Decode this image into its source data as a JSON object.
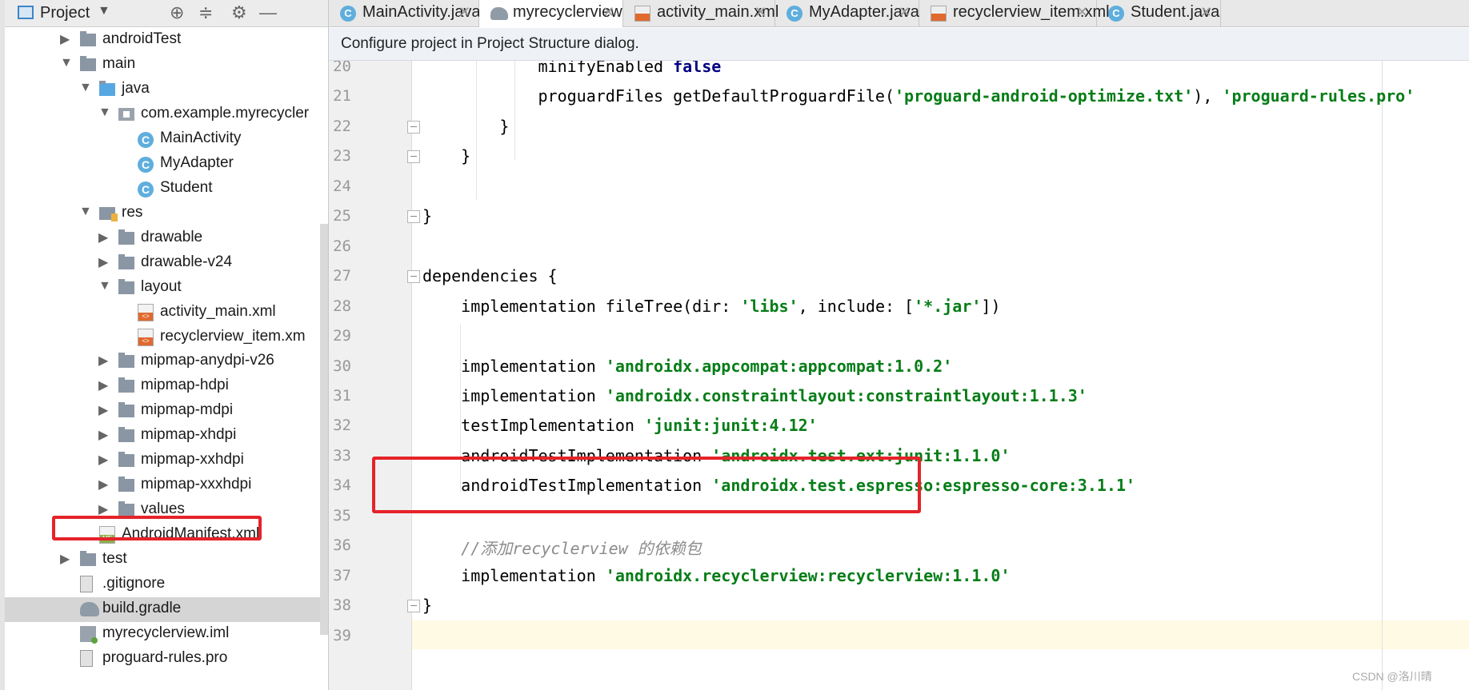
{
  "project_panel": {
    "title": "Project",
    "tree": [
      {
        "label": "androidTest",
        "icon": "folder-icon"
      },
      {
        "label": "main",
        "icon": "folder-icon"
      },
      {
        "label": "java",
        "icon": "java-folder-icon"
      },
      {
        "label": "com.example.myrecycler",
        "icon": "package-icon"
      },
      {
        "label": "MainActivity",
        "icon": "class-icon"
      },
      {
        "label": "MyAdapter",
        "icon": "class-icon"
      },
      {
        "label": "Student",
        "icon": "class-icon"
      },
      {
        "label": "res",
        "icon": "res-folder-icon"
      },
      {
        "label": "drawable",
        "icon": "folder-icon"
      },
      {
        "label": "drawable-v24",
        "icon": "folder-icon"
      },
      {
        "label": "layout",
        "icon": "folder-icon"
      },
      {
        "label": "activity_main.xml",
        "icon": "xml-file-icon"
      },
      {
        "label": "recyclerview_item.xm",
        "icon": "xml-file-icon"
      },
      {
        "label": "mipmap-anydpi-v26",
        "icon": "folder-icon"
      },
      {
        "label": "mipmap-hdpi",
        "icon": "folder-icon"
      },
      {
        "label": "mipmap-mdpi",
        "icon": "folder-icon"
      },
      {
        "label": "mipmap-xhdpi",
        "icon": "folder-icon"
      },
      {
        "label": "mipmap-xxhdpi",
        "icon": "folder-icon"
      },
      {
        "label": "mipmap-xxxhdpi",
        "icon": "folder-icon"
      },
      {
        "label": "values",
        "icon": "folder-icon"
      },
      {
        "label": "AndroidManifest.xml",
        "icon": "manifest-icon"
      },
      {
        "label": "test",
        "icon": "folder-icon"
      },
      {
        "label": ".gitignore",
        "icon": "text-file-icon"
      },
      {
        "label": "build.gradle",
        "icon": "gradle-icon",
        "selected": true
      },
      {
        "label": "myrecyclerview.iml",
        "icon": "iml-file-icon"
      },
      {
        "label": "proguard-rules.pro",
        "icon": "text-file-icon"
      }
    ]
  },
  "tabs": [
    {
      "label": "MainActivity.java",
      "icon": "class-icon"
    },
    {
      "label": "myrecyclerview",
      "icon": "gradle-icon",
      "active": true
    },
    {
      "label": "activity_main.xml",
      "icon": "xml-file-icon"
    },
    {
      "label": "MyAdapter.java",
      "icon": "class-icon"
    },
    {
      "label": "recyclerview_item.xml",
      "icon": "xml-file-icon"
    },
    {
      "label": "Student.java",
      "icon": "class-icon"
    }
  ],
  "banner": {
    "text": "Configure project in Project Structure dialog."
  },
  "editor": {
    "lines": [
      {
        "num": "20",
        "segments": [
          {
            "t": "            minifyEnabled ",
            "c": ""
          },
          {
            "t": "false",
            "c": "kw"
          }
        ]
      },
      {
        "num": "21",
        "segments": [
          {
            "t": "            proguardFiles getDefaultProguardFile(",
            "c": ""
          },
          {
            "t": "'proguard-android-optimize.txt'",
            "c": "str"
          },
          {
            "t": "), ",
            "c": ""
          },
          {
            "t": "'proguard-rules.pro'",
            "c": "str"
          }
        ]
      },
      {
        "num": "22",
        "segments": [
          {
            "t": "        }",
            "c": ""
          }
        ]
      },
      {
        "num": "23",
        "segments": [
          {
            "t": "    }",
            "c": ""
          }
        ]
      },
      {
        "num": "24",
        "segments": []
      },
      {
        "num": "25",
        "segments": [
          {
            "t": "}",
            "c": ""
          }
        ]
      },
      {
        "num": "26",
        "segments": []
      },
      {
        "num": "27",
        "segments": [
          {
            "t": "dependencies {",
            "c": ""
          }
        ]
      },
      {
        "num": "28",
        "segments": [
          {
            "t": "    implementation fileTree(dir: ",
            "c": ""
          },
          {
            "t": "'libs'",
            "c": "str"
          },
          {
            "t": ", include: [",
            "c": ""
          },
          {
            "t": "'*.jar'",
            "c": "str"
          },
          {
            "t": "])",
            "c": ""
          }
        ]
      },
      {
        "num": "29",
        "segments": []
      },
      {
        "num": "30",
        "segments": [
          {
            "t": "    implementation ",
            "c": ""
          },
          {
            "t": "'androidx.appcompat:appcompat:1.0.2'",
            "c": "str"
          }
        ]
      },
      {
        "num": "31",
        "segments": [
          {
            "t": "    implementation ",
            "c": ""
          },
          {
            "t": "'androidx.constraintlayout:constraintlayout:1.1.3'",
            "c": "str"
          }
        ]
      },
      {
        "num": "32",
        "segments": [
          {
            "t": "    testImplementation ",
            "c": ""
          },
          {
            "t": "'junit:junit:4.12'",
            "c": "str"
          }
        ]
      },
      {
        "num": "33",
        "segments": [
          {
            "t": "    androidTestImplementation ",
            "c": ""
          },
          {
            "t": "'androidx.test.ext:junit:1.1.0'",
            "c": "str"
          }
        ]
      },
      {
        "num": "34",
        "segments": [
          {
            "t": "    androidTestImplementation ",
            "c": ""
          },
          {
            "t": "'androidx.test.espresso:espresso-core:3.1.1'",
            "c": "str"
          }
        ]
      },
      {
        "num": "35",
        "segments": []
      },
      {
        "num": "36",
        "segments": [
          {
            "t": "    //添加recyclerview 的依赖包",
            "c": "cmt"
          }
        ]
      },
      {
        "num": "37",
        "segments": [
          {
            "t": "    implementation ",
            "c": ""
          },
          {
            "t": "'androidx.recyclerview:recyclerview:1.1.0'",
            "c": "str"
          }
        ]
      },
      {
        "num": "38",
        "segments": [
          {
            "t": "}",
            "c": ""
          }
        ]
      },
      {
        "num": "39",
        "segments": []
      }
    ]
  },
  "watermark": "CSDN @洛川晴",
  "colors": {
    "highlight_box": "#e5232a",
    "string": "#067d17",
    "keyword": "#000080",
    "comment": "#8c8c8c"
  }
}
